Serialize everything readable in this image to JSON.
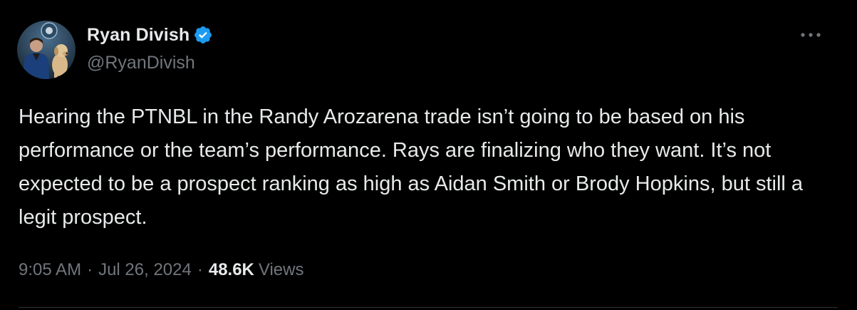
{
  "author": {
    "display_name": "Ryan Divish",
    "handle": "@RyanDivish",
    "verified": true,
    "verified_color": "#1d9bf0",
    "avatar_icon": "profile-photo"
  },
  "tweet": {
    "text": "Hearing the PTNBL in the Randy Arozarena trade isn’t going to be based on his performance or the team’s performance. Rays are finalizing who they want. It’s not expected to be a prospect ranking as high as Aidan Smith or Brody Hopkins, but still a legit prospect.",
    "time": "9:05 AM",
    "separator": "·",
    "date": "Jul 26, 2024",
    "views_count": "48.6K",
    "views_label": "Views"
  },
  "menu": {
    "more_icon": "more-icon"
  },
  "colors": {
    "background": "#000000",
    "primary_text": "#e7e9ea",
    "secondary_text": "#71767b"
  }
}
